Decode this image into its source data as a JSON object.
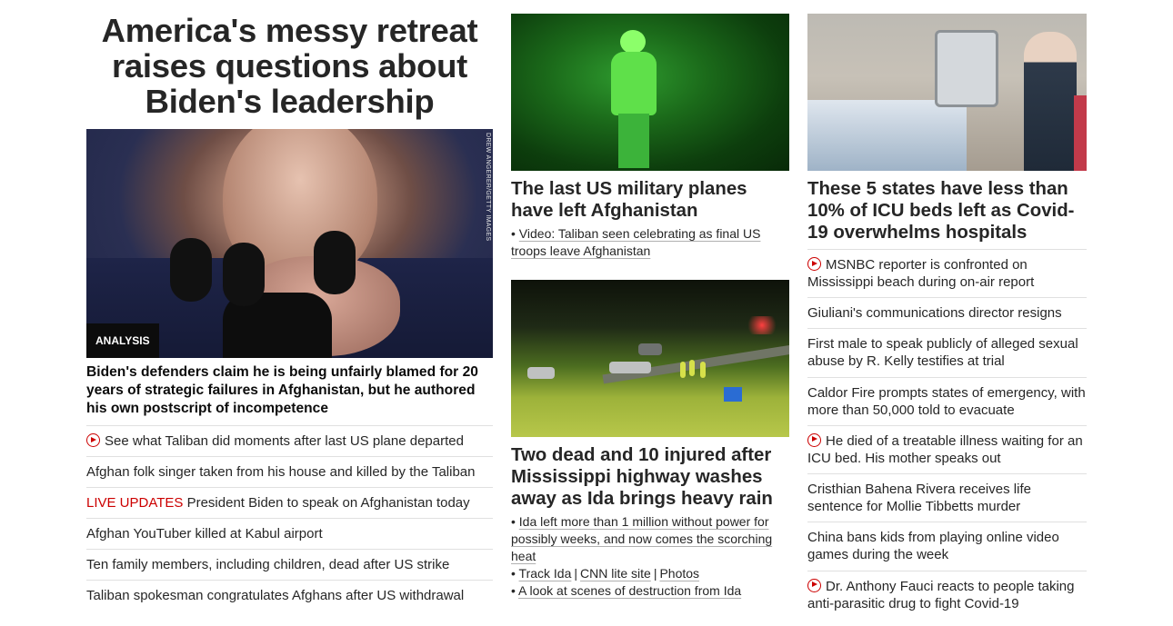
{
  "left": {
    "headline": "America's messy retreat raises questions about Biden's leadership",
    "image_credit": "DREW ANGERER/GETTY IMAGES",
    "tag": "ANALYSIS",
    "lead": "Biden's defenders claim he is being unfairly blamed for 20 years of strategic failures in Afghanistan, but he authored his own postscript of incompetence",
    "items": [
      {
        "text": "See what Taliban did moments after last US plane departed",
        "video": true
      },
      {
        "text": "Afghan folk singer taken from his house and killed by the Taliban"
      },
      {
        "live": "LIVE UPDATES",
        "text": " President Biden to speak on Afghanistan today"
      },
      {
        "text": "Afghan YouTuber killed at Kabul airport"
      },
      {
        "text": "Ten family members, including children, dead after US strike"
      },
      {
        "text": "Taliban spokesman congratulates Afghans after US withdrawal"
      }
    ]
  },
  "middle": {
    "story1": {
      "headline": "The last US military planes have left Afghanistan",
      "links": [
        "Video: Taliban seen celebrating as final US troops leave Afghanistan"
      ]
    },
    "story2": {
      "headline": "Two dead and 10 injured after Mississippi highway washes away as Ida brings heavy rain",
      "link1": "Ida left more than 1 million without power for possibly weeks, and now comes the scorching heat",
      "track": "Track Ida",
      "cnn_lite": "CNN lite site",
      "photos": "Photos",
      "sep": "|",
      "link3": "A look at scenes of destruction from Ida"
    }
  },
  "right": {
    "headline": "These 5 states have less than 10% of ICU beds left as Covid-19 overwhelms hospitals",
    "items": [
      {
        "text": "MSNBC reporter is confronted on Mississippi beach during on-air report",
        "video": true
      },
      {
        "text": "Giuliani's communications director resigns"
      },
      {
        "text": "First male to speak publicly of alleged sexual abuse by R. Kelly testifies at trial"
      },
      {
        "text": "Caldor Fire prompts states of emergency, with more than 50,000 told to evacuate"
      },
      {
        "text": "He died of a treatable illness waiting for an ICU bed. His mother speaks out",
        "video": true
      },
      {
        "text": "Cristhian Bahena Rivera receives life sentence for Mollie Tibbetts murder"
      },
      {
        "text": "China bans kids from playing online video games during the week"
      },
      {
        "text": "Dr. Anthony Fauci reacts to people taking anti-parasitic drug to fight Covid-19",
        "video": true
      }
    ]
  },
  "colors": {
    "live": "#cc0000",
    "text": "#262626",
    "divider": "#e0e0e0"
  }
}
